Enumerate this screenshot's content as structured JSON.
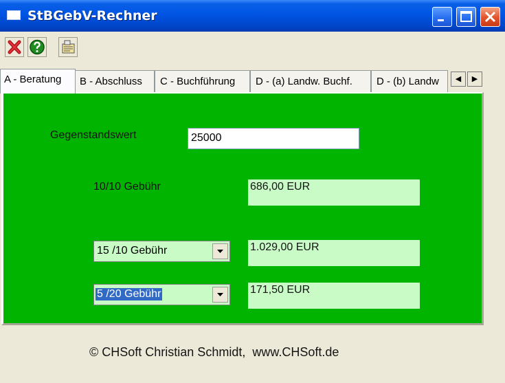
{
  "window": {
    "title": "StBGebV-Rechner"
  },
  "toolbar": {
    "buttons": [
      {
        "icon": "exit-icon"
      },
      {
        "icon": "help-icon"
      },
      {
        "icon": "info-icon"
      }
    ]
  },
  "tabs": [
    "A - Beratung",
    "B - Abschluss",
    "C - Buchführung",
    "D - (a) Landw. Buchf.",
    "D - (b) Landw"
  ],
  "form": {
    "gegenstandswert_label": "Gegenstandswert",
    "gegenstandswert_value": "25000",
    "fee_10_10_label": "10/10 Gebühr",
    "fee_10_10_value": "686,00 EUR",
    "combo1_value": "15 /10 Gebühr",
    "combo1_result": "1.029,00 EUR",
    "combo2_value": "5 /20 Gebühr",
    "combo2_result": "171,50 EUR"
  },
  "footer": {
    "text": "© CHSoft Christian Schmidt,  www.CHSoft.de"
  },
  "colors": {
    "panel": "#00b400",
    "output": "#c8fbc6",
    "titlebar": "#0054e3"
  }
}
